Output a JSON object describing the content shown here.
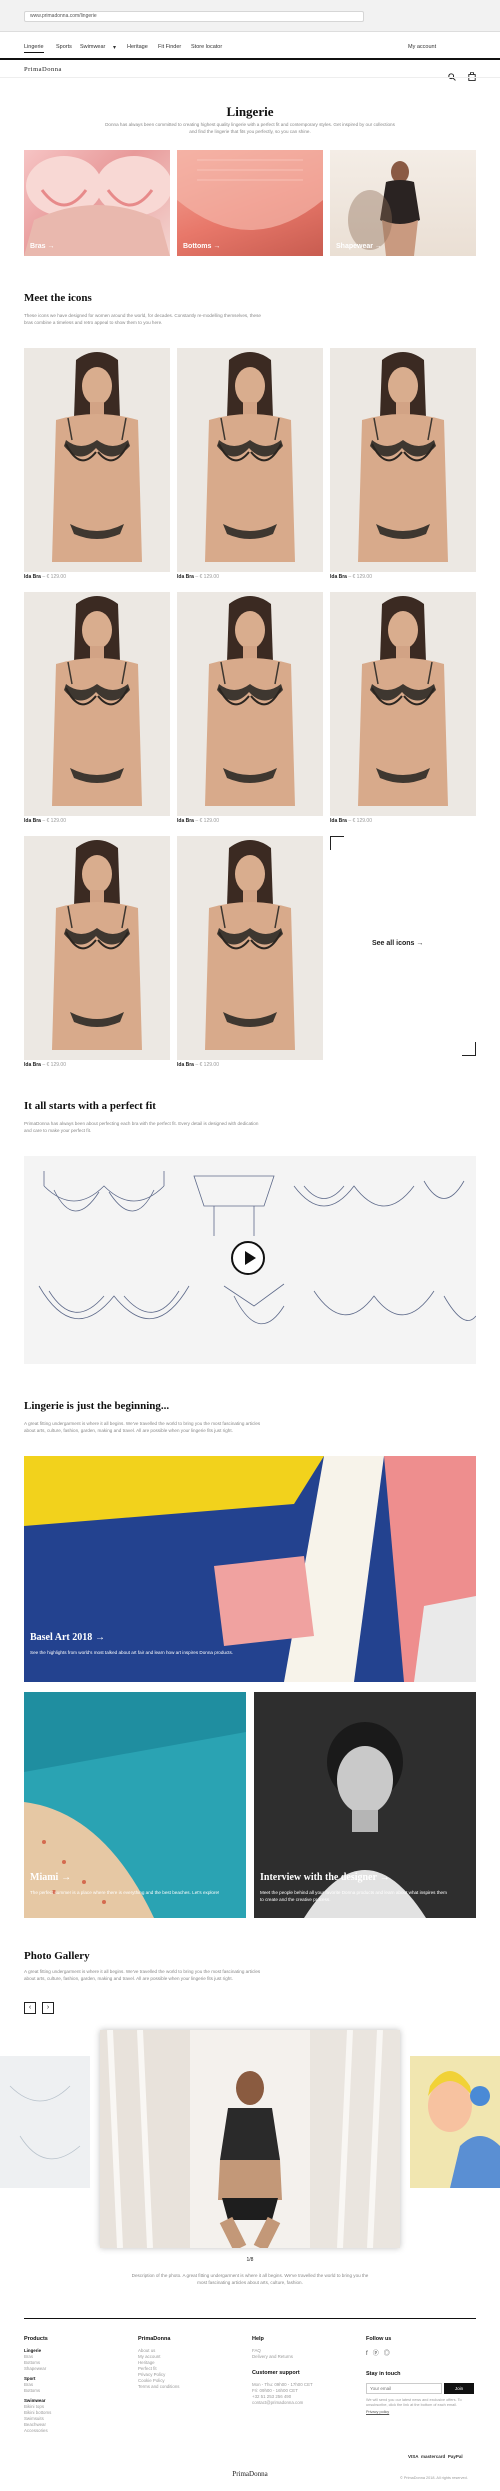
{
  "browser": {
    "url": "www.primadonna.com/lingerie"
  },
  "nav": {
    "items": [
      "Lingerie",
      "Sports",
      "Swimwear",
      "Heritage",
      "Fit Finder",
      "Store locator"
    ],
    "account": "My account"
  },
  "brand": {
    "logo": "PrimaDonna"
  },
  "lingerie": {
    "title": "Lingerie",
    "intro": "Donna has always been committed to creating highest quality lingerie with a perfect fit and contemporary styles. Get inspired by our collections and find the lingerie that fits you perfectly, so you can shine.",
    "categories": [
      "Bras",
      "Bottoms",
      "Shapewear"
    ]
  },
  "icons": {
    "title": "Meet the icons",
    "intro": "These icons we have designed for women around the world, for decades. Constantly re-modelling themselves, these bras combine a timeless and retro appeal to show them to you here.",
    "products": [
      {
        "name": "Ida Bra",
        "price": "€ 129.00"
      },
      {
        "name": "Ida Bra",
        "price": "€ 129.00"
      },
      {
        "name": "Ida Bra",
        "price": "€ 129.00"
      },
      {
        "name": "Ida Bra",
        "price": "€ 129.00"
      },
      {
        "name": "Ida Bra",
        "price": "€ 129.00"
      },
      {
        "name": "Ida Bra",
        "price": "€ 129.00"
      },
      {
        "name": "Ida Bra",
        "price": "€ 129.00"
      },
      {
        "name": "Ida Bra",
        "price": "€ 129.00"
      }
    ],
    "see_all": "See all icons"
  },
  "fit": {
    "title": "It all starts with a perfect fit",
    "intro": "PrimaDonna has always been about perfecting each bra with the perfect fit. Every detail is designed with dedication and care to make your perfect fit."
  },
  "beginning": {
    "title": "Lingerie is just the beginning...",
    "intro": "A great fitting undergarment is where it all begins. We've travelled the world to bring you the most fascinating articles about arts, culture, fashion, garden, making and travel. All are possible when your lingerie fits just right.",
    "feature": {
      "title": "Basel Art 2018",
      "text": "See the highlights from world's most talked about art fair and learn how art inspires Donna products."
    },
    "card1": {
      "title": "Miami",
      "text": "The perfect summer is a place where there is everything and the best beaches. Let's explore!"
    },
    "card2": {
      "title": "Interview with the designer",
      "text": "Meet the people behind all your favorite Donna products and learn about what inspires them to create and the creative process."
    }
  },
  "gallery": {
    "title": "Photo Gallery",
    "intro": "A great fitting undergarment is where it all begins. We've travelled the world to bring you the most fascinating articles about arts, culture, fashion, garden, making and travel. All are possible when your lingerie fits just right.",
    "counter": "1/8",
    "caption": "Description of the photo. A great fitting undergarment is where it all begins. We've travelled the world to bring you the most fascinating articles about arts, culture, fashion."
  },
  "footer": {
    "products": {
      "title": "Products",
      "items": [
        "Lingerie",
        "Bras",
        "Bottoms",
        "Shapewear",
        "Sport",
        "Bras",
        "Bottoms",
        "Swimwear",
        "Bikini tops",
        "Bikini bottoms",
        "Swimsuits",
        "Beachwear",
        "Accessories"
      ]
    },
    "primadonna": {
      "title": "PrimaDonna",
      "items": [
        "About us",
        "My account",
        "Heritage",
        "Perfect fit",
        "Privacy Policy",
        "Cookie Policy",
        "Terms and conditions"
      ]
    },
    "help": {
      "title": "Help",
      "items": [
        "FAQ",
        "Delivery and Returns"
      ]
    },
    "support": {
      "title": "Customer support",
      "lines": [
        "Mon - Thu: 09h00 - 17h00 CET",
        "Fri: 09h00 - 16h00 CET",
        "+32 51 253 256 490",
        "contact@primadonna.com"
      ]
    },
    "follow": {
      "title": "Follow us"
    },
    "touch": {
      "title": "Stay in touch",
      "placeholder": "Your email",
      "button": "Join",
      "note": "We will send you our latest news and exclusive offers. To unsubscribe, click the link at the bottom of each email.",
      "privacy": "Privacy policy"
    },
    "payments": [
      "VISA",
      "mastercard",
      "PayPal"
    ],
    "logo": "PrimaDonna",
    "copyright": "© PrimaDonna 2018. All rights reserved."
  }
}
